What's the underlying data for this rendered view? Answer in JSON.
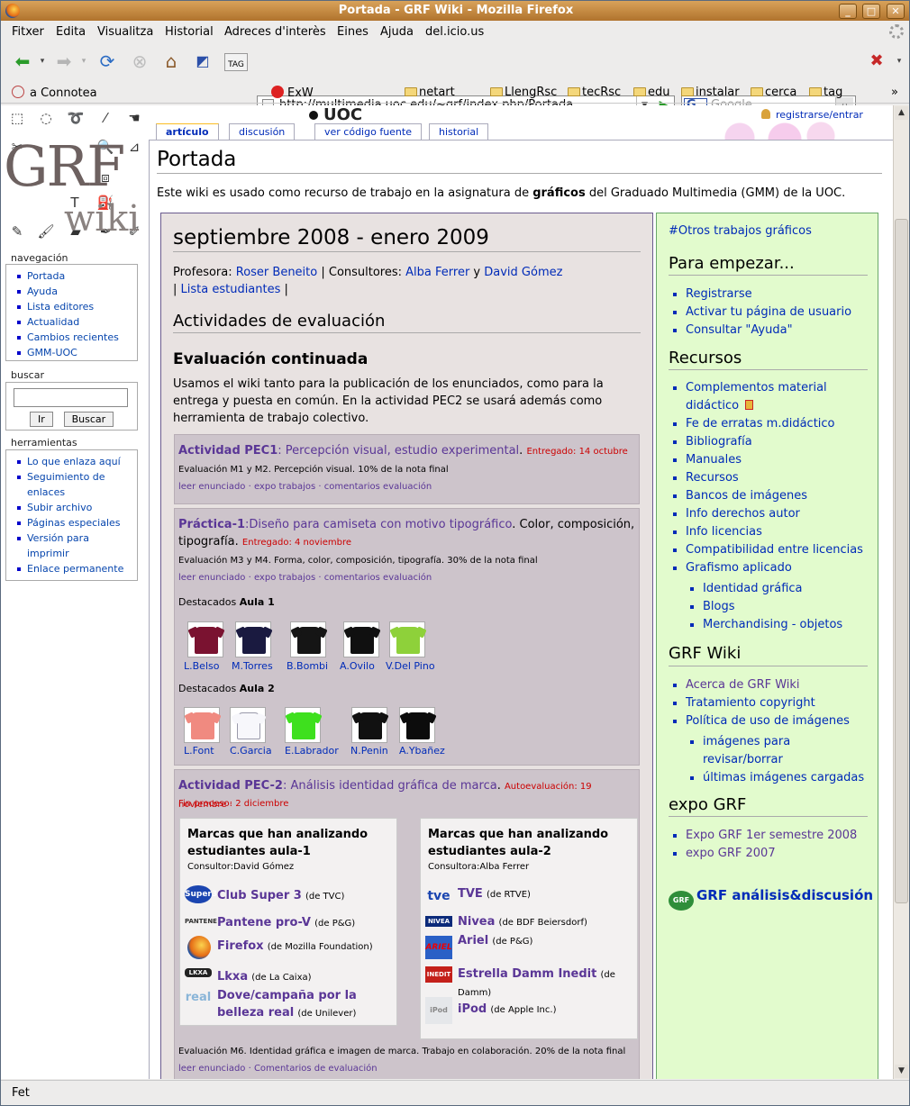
{
  "window": {
    "title": "Portada - GRF Wiki - Mozilla Firefox"
  },
  "menu": [
    "Fitxer",
    "Edita",
    "Visualitza",
    "Historial",
    "Adreces d'interès",
    "Eines",
    "Ajuda",
    "del.icio.us"
  ],
  "nav": {
    "url": "http://multimedia.uoc.edu/~grf/index.php/Portada",
    "search_placeholder": "Google",
    "search_engine": "G",
    "tag_label": "TAG"
  },
  "bookmarks": [
    "a Connotea",
    "ExW",
    "netart",
    "LlengRsc",
    "tecRsc",
    "edu",
    "instalar",
    "cerca",
    "tag"
  ],
  "bm_more": "»",
  "status": "Fet",
  "wiki": {
    "logo_main": "GRF",
    "logo_sub": "wiki",
    "uoc": "UOC",
    "user_link": "registrarse/entrar",
    "tabs": [
      "artículo",
      "discusión",
      "ver código fuente",
      "historial"
    ],
    "nav_title": "navegación",
    "nav_items": [
      "Portada",
      "Ayuda",
      "Lista editores",
      "Actualidad",
      "Cambios recientes",
      "GMM-UOC"
    ],
    "search_title": "buscar",
    "search_go": "Ir",
    "search_btn": "Buscar",
    "tools_title": "herramientas",
    "tools_items": [
      "Lo que enlaza aquí",
      "Seguimiento de enlaces",
      "Subir archivo",
      "Páginas especiales",
      "Versión para imprimir",
      "Enlace permanente"
    ],
    "page_title": "Portada",
    "intro_a": "Este wiki es usado como recurso de trabajo en la asignatura de ",
    "intro_b": "gráficos",
    "intro_c": " del Graduado Multimedia (GMM) de la UOC."
  },
  "left": {
    "heading": "septiembre 2008 - enero 2009",
    "prof_label": "Profesora: ",
    "prof": "Roser Beneito",
    "cons_label": " | Consultores: ",
    "cons1": "Alba Ferrer",
    "y": " y ",
    "cons2": "David Gómez",
    "sep1": "| ",
    "lista": "Lista estudiantes",
    "sep2": " |",
    "h_act": "Actividades de evaluación",
    "h_cont": "Evaluación continuada",
    "p_cont": "Usamos el wiki tanto para la publicación de los enunciados, como para la entrega y puesta en común. En la actividad PEC2 se usará además como herramienta de trabajo colectivo.",
    "pec1": {
      "title": "Actividad PEC1",
      "sub": ": Percepción visual, estudio experimental",
      "dot": ".",
      "deliv": "Entregado: 14 octubre",
      "desc": "Evaluación M1 y M2. Percepción visual. 10% de la nota final",
      "links": "leer enunciado · expo trabajos · comentarios evaluación"
    },
    "prac1": {
      "title": "Práctica-1",
      "sub": ":Diseño para camiseta con motivo tipográfico",
      "rest": ". Color, composición, tipografía. ",
      "deliv": "Entregado: 4 noviembre",
      "desc": "Evaluación M3 y M4. Forma, color, composición, tipografía. 30% de la nota final",
      "links": "leer enunciado · expo trabajos · comentarios evaluación"
    },
    "dest1_a": "Destacados ",
    "dest1_b": "Aula 1",
    "aula1": [
      "L.Belso",
      "M.Torres",
      "B.Bombi",
      "A.Ovilo",
      "V.Del Pino"
    ],
    "dest2_a": "Destacados ",
    "dest2_b": "Aula 2",
    "aula2": [
      "L.Font",
      "C.Garcia",
      "E.Labrador",
      "N.Penin",
      "A.Ybañez"
    ],
    "pec2": {
      "title": "Actividad PEC-2",
      "sub": ": Análisis identidad gráfica de marca",
      "dot": ". ",
      "auto": "Autoevaluación: 19 noviembre ·",
      "fin": "Fin proceso: 2 diciembre",
      "desc": "Evaluación M6. Identidad gráfica e imagen de marca. Trabajo en colaboración. 20% de la nota final",
      "links": "leer enunciado · Comentarios de evaluación"
    },
    "b1": {
      "title": "Marcas que han analizando estudiantes aula-1",
      "cons": "Consultor:David Gómez",
      "items": [
        {
          "n": "Club Super 3",
          "o": "(de TVC)"
        },
        {
          "n": "Pantene pro-V",
          "o": "(de P&G)"
        },
        {
          "n": "Firefox",
          "o": "(de Mozilla Foundation)"
        },
        {
          "n": "Lkxa",
          "o": "(de La Caixa)"
        },
        {
          "n": "Dove/campaña por la belleza real",
          "o": "(de Unilever)"
        }
      ],
      "logos": [
        "Super3",
        "PANTENE",
        "",
        "LKXA",
        "real"
      ]
    },
    "b2": {
      "title": "Marcas que han analizando estudiantes aula-2",
      "cons": "Consultora:Alba Ferrer",
      "items": [
        {
          "n": "TVE",
          "o": "(de RTVE)"
        },
        {
          "n": "Nivea",
          "o": "(de BDF Beiersdorf)"
        },
        {
          "n": "Ariel",
          "o": "(de P&G)"
        },
        {
          "n": "Estrella Damm Inedit",
          "o": "(de Damm)"
        },
        {
          "n": "iPod",
          "o": "(de Apple Inc.)"
        }
      ],
      "logos": [
        "tve",
        "NIVEA",
        "ARIEL",
        "INEDIT",
        "iPod"
      ]
    }
  },
  "right": {
    "otros": "#Otros trabajos gráficos",
    "h1": "Para empezar...",
    "l1": [
      "Registrarse",
      "Activar tu página de usuario",
      "Consultar \"Ayuda\""
    ],
    "h2": "Recursos",
    "l2": [
      "Complementos material didáctico",
      "Fe de erratas m.didáctico",
      "Bibliografía",
      "Manuales",
      "Recursos",
      "Bancos de imágenes",
      "Info derechos autor",
      "Info licencias",
      "Compatibilidad entre licencias",
      "Grafismo aplicado"
    ],
    "l2sub": [
      "Identidad gráfica",
      "Blogs",
      "Merchandising - objetos"
    ],
    "h3": "GRF Wiki",
    "l3": [
      "Acerca de GRF Wiki",
      "Tratamiento copyright",
      "Política de uso de imágenes"
    ],
    "l3sub": [
      "imágenes para revisar/borrar",
      "últimas imágenes cargadas"
    ],
    "h4": "expo GRF",
    "l4": [
      "Expo GRF 1er semestre 2008",
      "expo GRF 2007"
    ],
    "forum": "GRF análisis&discusión",
    "forum_badge": "GRF"
  }
}
